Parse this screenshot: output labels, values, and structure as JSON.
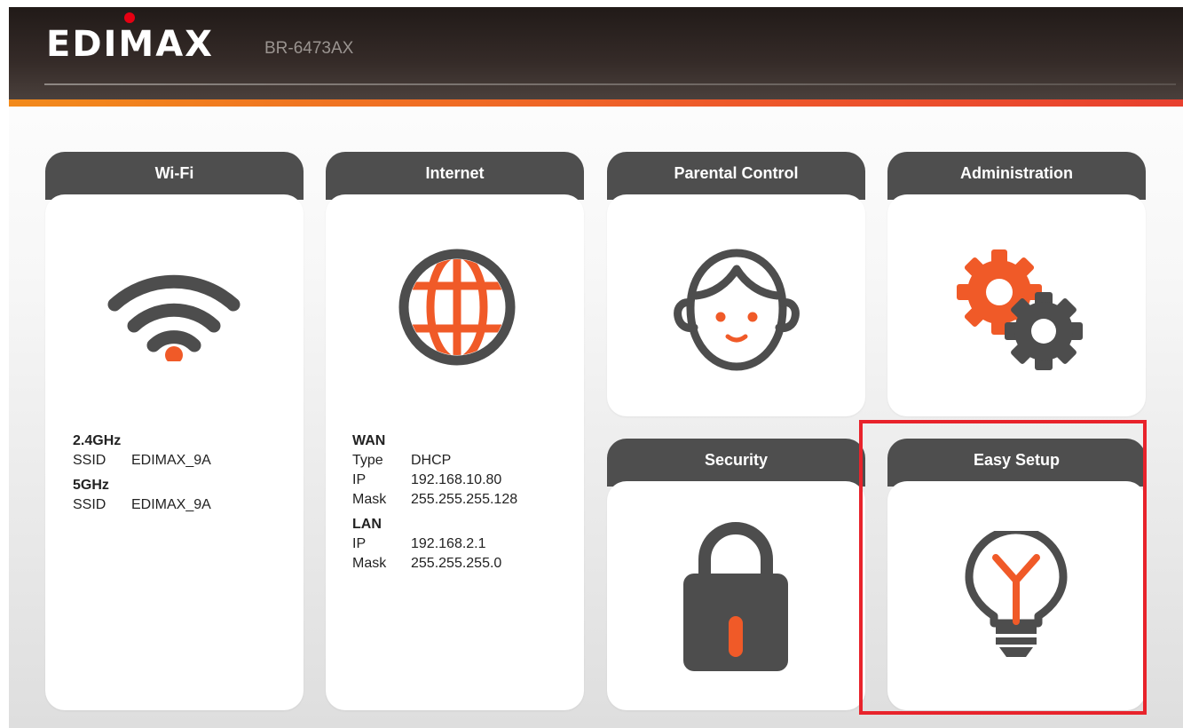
{
  "header": {
    "brand": "EDIMAX",
    "model": "BR-6473AX"
  },
  "cards": {
    "wifi": {
      "title": "Wi-Fi",
      "icon": "wifi-icon",
      "band_24": "2.4GHz",
      "ssid_label_24": "SSID",
      "ssid_24": "EDIMAX_9A",
      "band_5": "5GHz",
      "ssid_label_5": "SSID",
      "ssid_5": "EDIMAX_9A"
    },
    "internet": {
      "title": "Internet",
      "icon": "globe-icon",
      "wan": {
        "heading": "WAN",
        "type_label": "Type",
        "type": "DHCP",
        "ip_label": "IP",
        "ip": "192.168.10.80",
        "mask_label": "Mask",
        "mask": "255.255.255.128"
      },
      "lan": {
        "heading": "LAN",
        "ip_label": "IP",
        "ip": "192.168.2.1",
        "mask_label": "Mask",
        "mask": "255.255.255.0"
      }
    },
    "parental": {
      "title": "Parental Control",
      "icon": "child-face-icon"
    },
    "admin": {
      "title": "Administration",
      "icon": "gears-icon"
    },
    "security": {
      "title": "Security",
      "icon": "padlock-icon"
    },
    "easy_setup": {
      "title": "Easy Setup",
      "icon": "lightbulb-icon"
    }
  },
  "colors": {
    "accent": "#f05a28",
    "icon_dark": "#4d4d4d",
    "card_header": "#4e4e4e",
    "highlight": "#e8232b"
  }
}
